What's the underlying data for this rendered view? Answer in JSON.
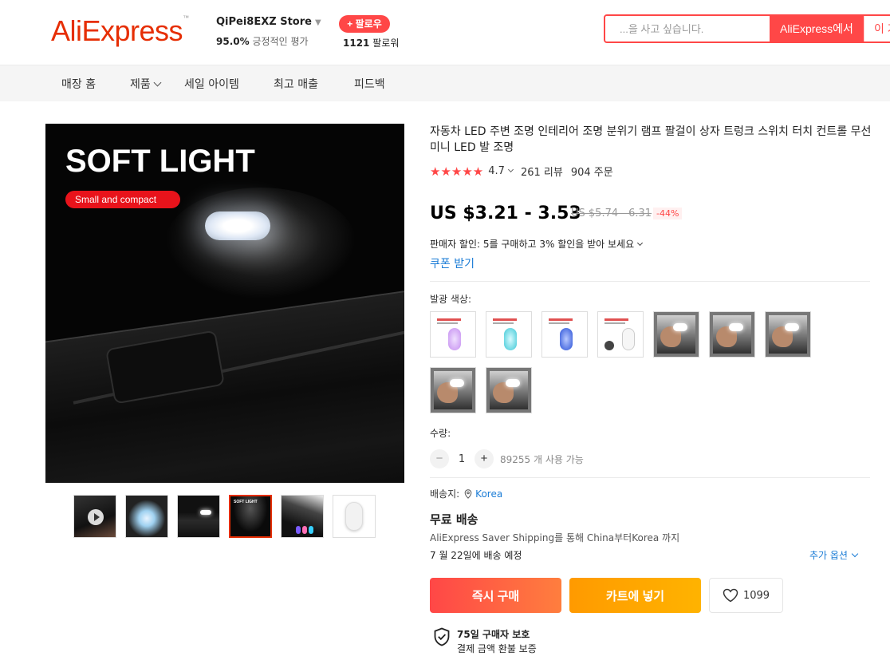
{
  "header": {
    "logo": "AliExpress",
    "store": {
      "name": "QiPei8EXZ Store",
      "rating_value": "95.0%",
      "rating_label": "긍정적인 평가",
      "follow_label": "+ 팔로우",
      "followers_count": "1121",
      "followers_label": "팔로워"
    },
    "search": {
      "placeholder": "...을 사고 싶습니다.",
      "button_aliexpress": "AliExpress에서",
      "button_store": "이 가"
    }
  },
  "nav": {
    "items": [
      {
        "label": "매장 홈"
      },
      {
        "label": "제품"
      },
      {
        "label": "세일 아이템"
      },
      {
        "label": "최고 매출"
      },
      {
        "label": "피드백"
      }
    ]
  },
  "gallery": {
    "main_title": "SOFT LIGHT",
    "main_subtitle": "Small and compact",
    "thumb_count": 6,
    "active_thumb_index": 3
  },
  "product": {
    "title": "자동차 LED 주변 조명 인테리어 조명 분위기 램프 팔걸이 상자 트렁크 스위치 터치 컨트롤 무선 미니 LED 발 조명",
    "stars": "★★★★★",
    "rating": "4.7",
    "reviews": "261 리뷰",
    "orders": "904 주문",
    "price": "US $3.21 - 3.53",
    "old_price": "US $5.74 - 6.31",
    "discount": "-44%",
    "promo": "판매자 할인: 5를 구매하고 3% 할인을 받아 보세요",
    "coupon": "쿠폰 받기",
    "color_label": "발광 색상:",
    "colors": [
      {
        "type": "lamp",
        "color": "#c58ef0"
      },
      {
        "type": "lamp",
        "color": "#3ec8d6"
      },
      {
        "type": "lamp",
        "color": "#2a52d8"
      },
      {
        "type": "lamp",
        "color": "#f1f1f1"
      },
      {
        "type": "photo"
      },
      {
        "type": "photo"
      },
      {
        "type": "photo"
      },
      {
        "type": "photo"
      },
      {
        "type": "photo"
      }
    ],
    "quantity_label": "수량:",
    "quantity": "1",
    "available": "89255 개 사용 가능",
    "ship_to_label": "배송지:",
    "ship_to_country": "Korea",
    "free_shipping": "무료 배송",
    "ship_method": "AliExpress Saver Shipping를 통해 China부터Korea 까지",
    "ship_date": "7 월 22일에 배송 예정",
    "more_options": "추가 옵션",
    "buy_now": "즉시 구매",
    "add_to_cart": "카트에 넣기",
    "wishlist_count": "1099",
    "protection_title": "75일 구매자 보호",
    "protection_sub": "결제 금액 환불 보증"
  },
  "colors": {
    "accent": "#ff4747",
    "brand": "#e62e04",
    "link": "#1b7cd6",
    "cart": "#ffa200"
  }
}
